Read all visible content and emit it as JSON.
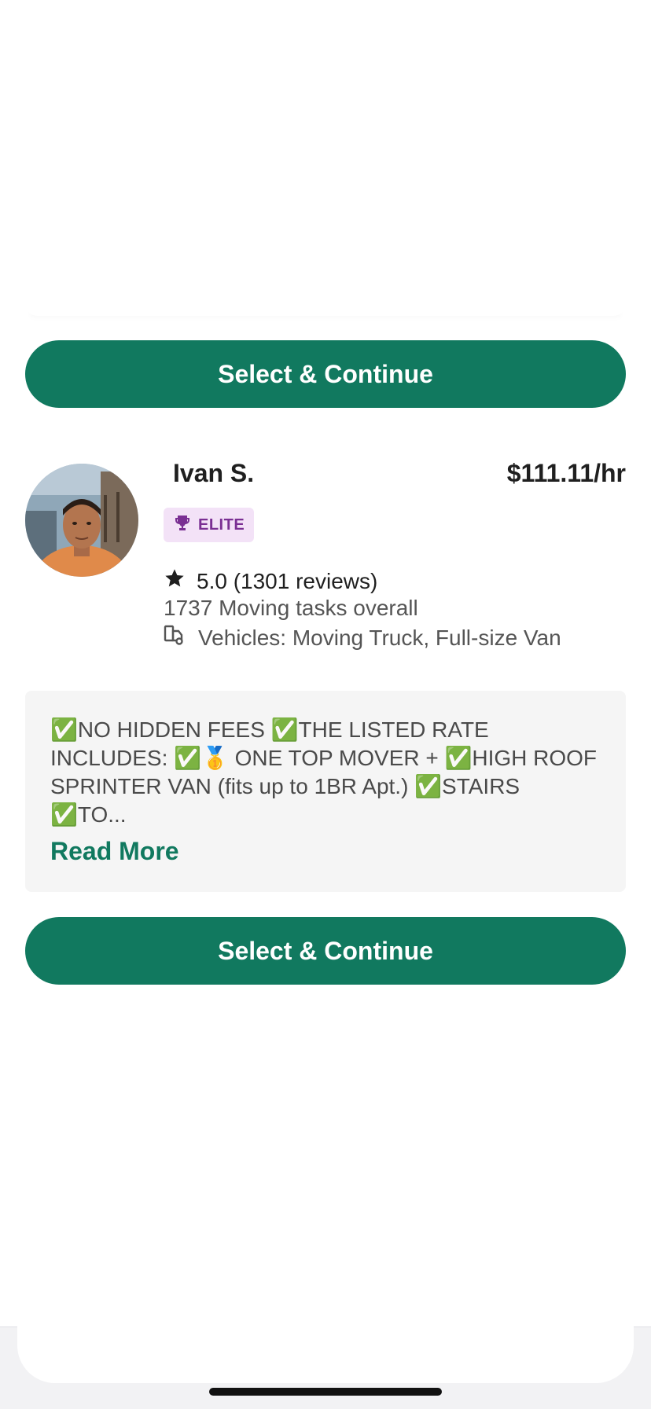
{
  "buttons": {
    "select_continue_top": "Select & Continue",
    "select_continue_bottom": "Select & Continue"
  },
  "tasker": {
    "name": "Ivan S.",
    "price": "$111.11/hr",
    "badge": "ELITE",
    "rating": "5.0 (1301 reviews)",
    "tasks": "1737 Moving tasks overall",
    "vehicles": "Vehicles: Moving Truck, Full-size Van",
    "description": "✅NO HIDDEN FEES ✅THE LISTED RATE INCLUDES: ✅🥇 ONE TOP MOVER + ✅HIGH ROOF SPRINTER VAN (fits up to 1BR Apt.) ✅STAIRS ✅TO...",
    "read_more": "Read More"
  },
  "colors": {
    "primary": "#11795f",
    "badge_bg": "#f3e2f7",
    "badge_text": "#7a2f93",
    "description_bg": "#f5f5f5"
  },
  "icons": [
    "trophy-icon",
    "star-icon",
    "truck-icon"
  ]
}
